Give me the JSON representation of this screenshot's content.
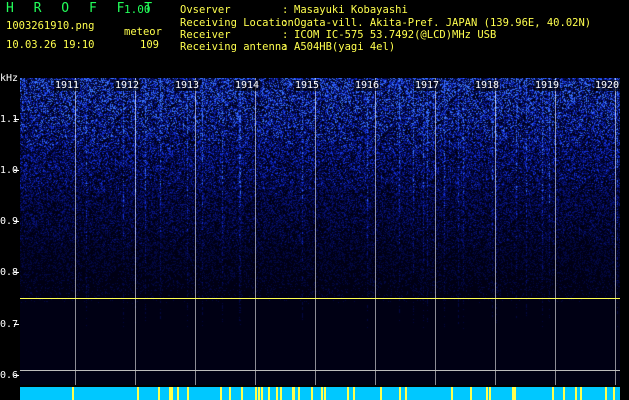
{
  "header": {
    "app_title": "H R O F F T",
    "app_version": "1.00",
    "filename": "1003261910.png",
    "datetime": "10.03.26 19:10",
    "mode": "meteor",
    "count": "109"
  },
  "info": [
    {
      "label": "Ovserver",
      "value": "Masayuki Kobayashi"
    },
    {
      "label": "Receiving Location",
      "value": "Ogata-vill. Akita-Pref. JAPAN (139.96E, 40.02N)"
    },
    {
      "label": "Receiver",
      "value": "ICOM IC-575 53.7492(@LCD)MHz USB"
    },
    {
      "label": "Receiving antenna",
      "value": "A504HB(yagi 4el)"
    }
  ],
  "info_separator": ":",
  "chart_data": {
    "type": "heatmap",
    "ylabel": "kHz",
    "yticks": [
      "1.1",
      "1.0",
      "0.9",
      "0.8",
      "0.7",
      "0.6"
    ],
    "ylim": [
      0.58,
      1.18
    ],
    "x_time_labels": [
      "1911",
      "1912",
      "1913",
      "1914",
      "1915",
      "1916",
      "1917",
      "1918",
      "1919",
      "1920"
    ],
    "carrier_khz": 0.75,
    "colors": {
      "background": "#02021a",
      "signal": "#2a4fff",
      "carrier": "#ffff4e",
      "bar": "#00c8ff"
    }
  }
}
